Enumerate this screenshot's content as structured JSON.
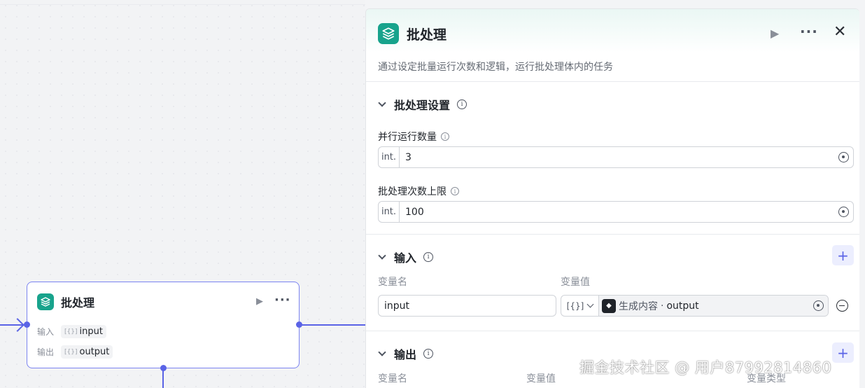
{
  "node": {
    "title": "批处理",
    "input_label": "输入",
    "input_value": "input",
    "output_label": "输出",
    "output_value": "output"
  },
  "panel": {
    "title": "批处理",
    "description": "通过设定批量运行次数和逻辑，运行批处理体内的任务",
    "settings": {
      "heading": "批处理设置",
      "parallel": {
        "label": "并行运行数量",
        "type": "int.",
        "value": "3"
      },
      "limit": {
        "label": "批处理次数上限",
        "type": "int.",
        "value": "100"
      }
    },
    "input": {
      "heading": "输入",
      "col_name": "变量名",
      "col_value": "变量值",
      "row": {
        "name": "input",
        "type": "[{}]",
        "ref_source": "生成内容",
        "ref_sep": "·",
        "ref_var": "output"
      }
    },
    "output": {
      "heading": "输出",
      "col_name": "变量名",
      "col_value": "变量值",
      "col_type": "变量类型"
    }
  },
  "watermark": "掘金技术社区 @ 用户87992814860",
  "colors": {
    "accent": "#5a63e6",
    "brand": "#18a38c"
  }
}
